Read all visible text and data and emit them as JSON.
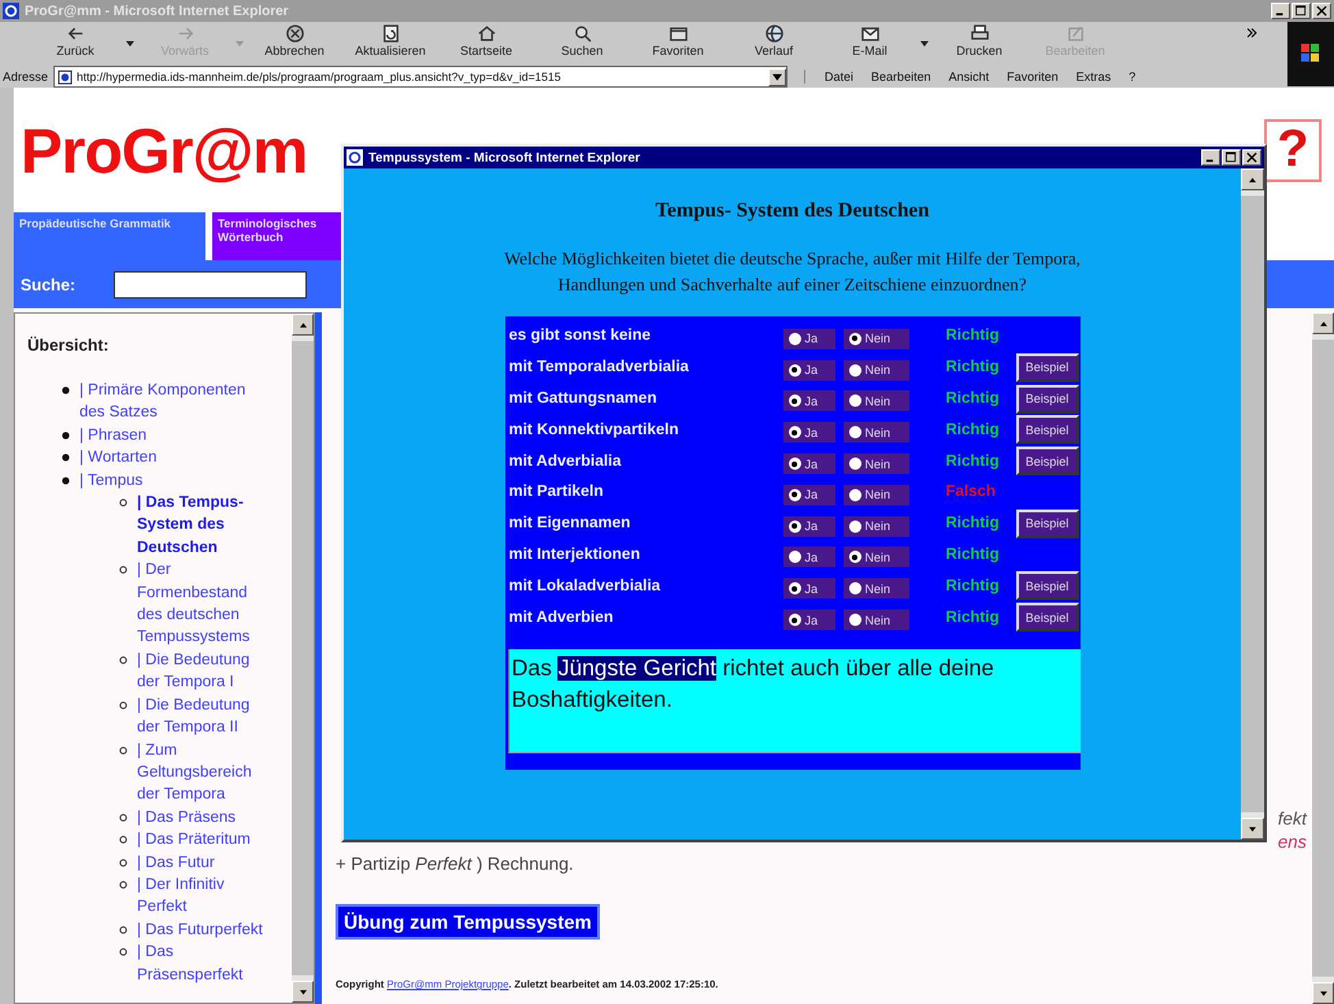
{
  "browser": {
    "title": "ProGr@mm - Microsoft Internet Explorer",
    "toolbar": [
      {
        "label": "Zurück",
        "disabled": false,
        "dropdown": true
      },
      {
        "label": "Vorwärts",
        "disabled": true,
        "dropdown": true
      },
      {
        "label": "Abbrechen",
        "disabled": false,
        "dropdown": false
      },
      {
        "label": "Aktualisieren",
        "disabled": false,
        "dropdown": false
      },
      {
        "label": "Startseite",
        "disabled": false,
        "dropdown": false
      },
      {
        "label": "Suchen",
        "disabled": false,
        "dropdown": false
      },
      {
        "label": "Favoriten",
        "disabled": false,
        "dropdown": false
      },
      {
        "label": "Verlauf",
        "disabled": false,
        "dropdown": false
      },
      {
        "label": "E-Mail",
        "disabled": false,
        "dropdown": true
      },
      {
        "label": "Drucken",
        "disabled": false,
        "dropdown": false
      },
      {
        "label": "Bearbeiten",
        "disabled": true,
        "dropdown": false
      }
    ],
    "address": {
      "label": "Adresse",
      "url": "http://hypermedia.ids-mannheim.de/pls/prograam/prograam_plus.ansicht?v_typ=d&v_id=1515"
    },
    "menu": [
      "Datei",
      "Bearbeiten",
      "Ansicht",
      "Favoriten",
      "Extras",
      "?"
    ]
  },
  "page": {
    "logo": "ProGr@m",
    "help": "?",
    "tabs": [
      {
        "label": "Propädeutische Grammatik",
        "color": "#3366ff"
      },
      {
        "label": "Terminologisches Wörterbuch",
        "color": "#8000ff"
      }
    ],
    "search_label": "Suche:",
    "sidebar": {
      "title": "Übersicht:",
      "items": [
        {
          "label": "| Primäre Komponenten des Satzes",
          "selected": false
        },
        {
          "label": "| Phrasen",
          "selected": false
        },
        {
          "label": "| Wortarten",
          "selected": false
        },
        {
          "label": "| Tempus",
          "selected": false,
          "children": [
            {
              "label": "| Das Tempus-System des Deutschen",
              "selected": true
            },
            {
              "label": "| Der Formenbestand des deutschen Tempussystems",
              "selected": false
            },
            {
              "label": "| Die Bedeutung der Tempora I",
              "selected": false
            },
            {
              "label": "| Die Bedeutung der Tempora II",
              "selected": false
            },
            {
              "label": "| Zum Geltungsbereich der Tempora",
              "selected": false
            },
            {
              "label": "| Das Präsens",
              "selected": false
            },
            {
              "label": "| Das Präteritum",
              "selected": false
            },
            {
              "label": "| Das Futur",
              "selected": false
            },
            {
              "label": "| Der Infinitiv Perfekt",
              "selected": false
            },
            {
              "label": "| Das Futurperfekt",
              "selected": false
            },
            {
              "label": "| Das Präsensperfekt",
              "selected": false
            }
          ]
        }
      ]
    },
    "content": {
      "fragments": [
        {
          "text": "fekt",
          "color": "#555555"
        },
        {
          "text": "ens",
          "color": "#cc3366"
        }
      ],
      "paragraph": "+ Partizip *Perfekt* ) Rechnung.",
      "exercise_button": "Übung zum Tempussystem",
      "copyright": {
        "before": "Copyright ",
        "link": "ProGr@mm Projektgruppe",
        "after": ". Zuletzt bearbeitet am 14.03.2002 17:25:10."
      }
    }
  },
  "popup": {
    "title": "Tempussystem - Microsoft Internet Explorer",
    "heading": "Tempus- System des Deutschen",
    "question": "Welche Möglichkeiten bietet die deutsche Sprache, außer mit Hilfe der Tempora, Handlungen und Sachverhalte auf einer Zeitschiene einzuordnen?",
    "rows": [
      {
        "label": "es gibt sonst keine",
        "options": [
          {
            "label": "Ja",
            "selected": false
          },
          {
            "label": "Nein",
            "selected": true
          }
        ],
        "result": {
          "text": "Richtig",
          "correct": true
        }
      },
      {
        "label": "mit Temporaladverbialia",
        "options": [
          {
            "label": "Ja",
            "selected": true
          },
          {
            "label": "Nein",
            "selected": false
          }
        ],
        "result": {
          "text": "Richtig",
          "correct": true
        },
        "example_button": "Beispiel"
      },
      {
        "label": "mit Gattungsnamen",
        "options": [
          {
            "label": "Ja",
            "selected": true
          },
          {
            "label": "Nein",
            "selected": false
          }
        ],
        "result": {
          "text": "Richtig",
          "correct": true
        },
        "example_button": "Beispiel"
      },
      {
        "label": "mit Konnektivpartikeln",
        "options": [
          {
            "label": "Ja",
            "selected": true
          },
          {
            "label": "Nein",
            "selected": false
          }
        ],
        "result": {
          "text": "Richtig",
          "correct": true
        },
        "example_button": "Beispiel"
      },
      {
        "label": "mit Adverbialia",
        "options": [
          {
            "label": "Ja",
            "selected": true
          },
          {
            "label": "Nein",
            "selected": false
          }
        ],
        "result": {
          "text": "Richtig",
          "correct": true
        },
        "example_button": "Beispiel"
      },
      {
        "label": "mit Partikeln",
        "options": [
          {
            "label": "Ja",
            "selected": true
          },
          {
            "label": "Nein",
            "selected": false
          }
        ],
        "result": {
          "text": "Falsch",
          "correct": false
        }
      },
      {
        "label": "mit Eigennamen",
        "options": [
          {
            "label": "Ja",
            "selected": true
          },
          {
            "label": "Nein",
            "selected": false
          }
        ],
        "result": {
          "text": "Richtig",
          "correct": true
        },
        "example_button": "Beispiel"
      },
      {
        "label": "mit Interjektionen",
        "options": [
          {
            "label": "Ja",
            "selected": false
          },
          {
            "label": "Nein",
            "selected": true
          }
        ],
        "result": {
          "text": "Richtig",
          "correct": true
        }
      },
      {
        "label": "mit Lokaladverbialia",
        "options": [
          {
            "label": "Ja",
            "selected": true
          },
          {
            "label": "Nein",
            "selected": false
          }
        ],
        "result": {
          "text": "Richtig",
          "correct": true
        },
        "example_button": "Beispiel"
      },
      {
        "label": "mit Adverbien",
        "options": [
          {
            "label": "Ja",
            "selected": true
          },
          {
            "label": "Nein",
            "selected": false
          }
        ],
        "result": {
          "text": "Richtig",
          "correct": true
        },
        "example_button": "Beispiel"
      }
    ],
    "example": {
      "before": "Das ",
      "selected": "Jüngste Gericht",
      "after": " richtet auch über alle deine Boshaftigkeiten."
    }
  }
}
